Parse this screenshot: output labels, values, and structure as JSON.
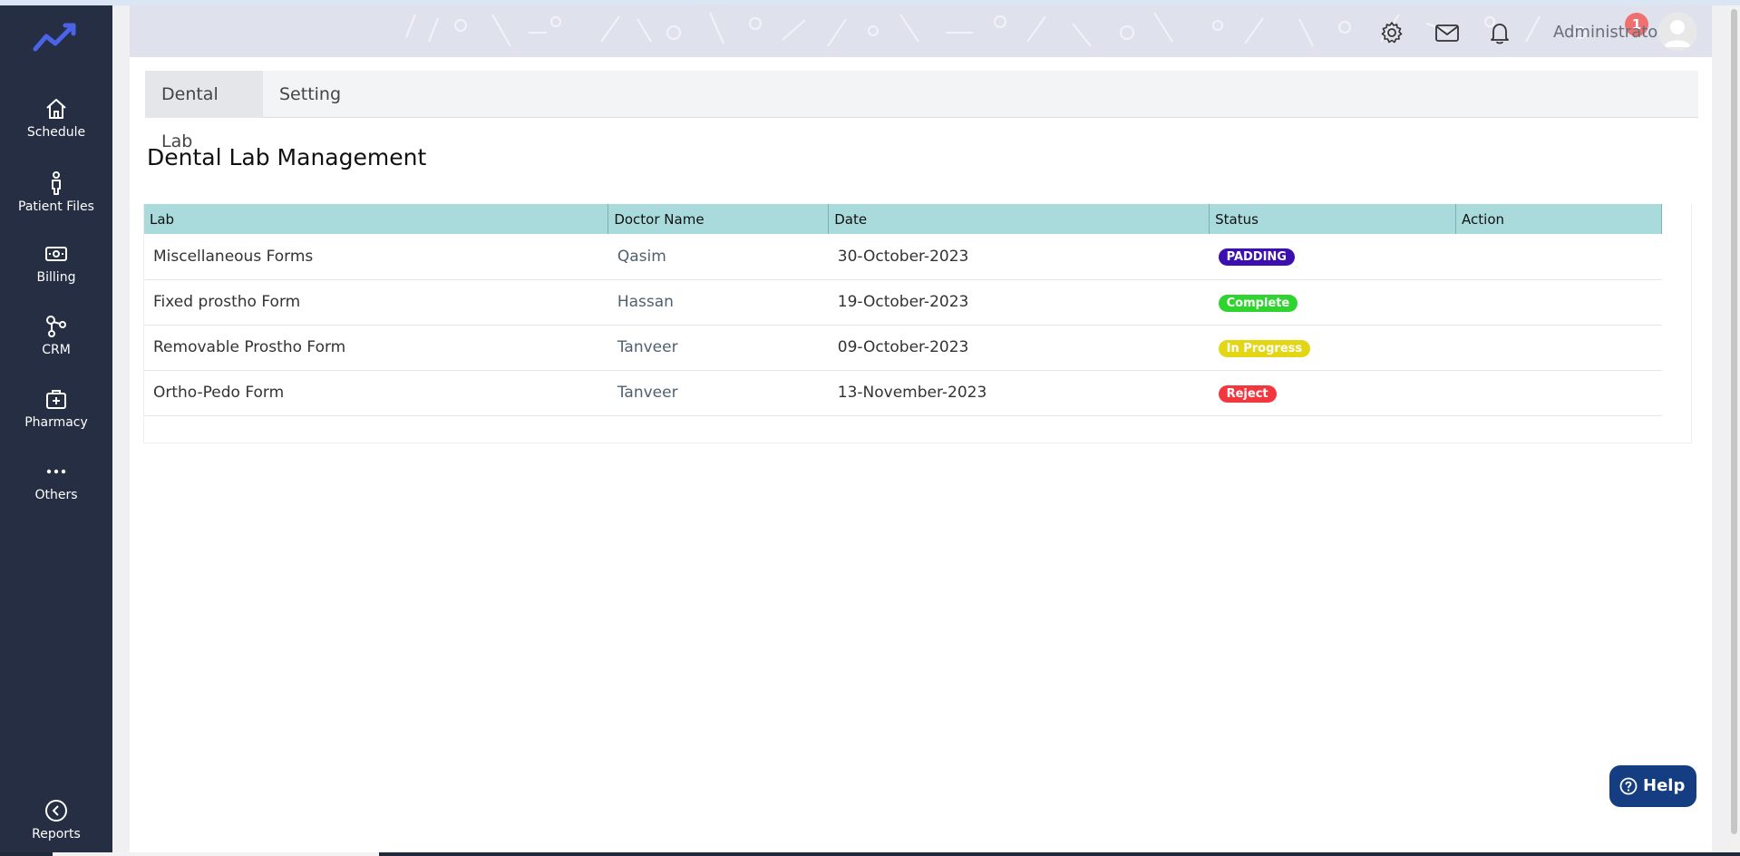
{
  "sidebar": {
    "items": [
      {
        "label": "Schedule",
        "icon": "home-icon"
      },
      {
        "label": "Patient Files",
        "icon": "person-icon"
      },
      {
        "label": "Billing",
        "icon": "money-icon"
      },
      {
        "label": "CRM",
        "icon": "network-icon"
      },
      {
        "label": "Pharmacy",
        "icon": "medkit-icon"
      },
      {
        "label": "Others",
        "icon": "dots-icon"
      }
    ],
    "reports_label": "Reports"
  },
  "header": {
    "user_name": "Administrator",
    "notification_count": "1"
  },
  "tabs": [
    {
      "label": "Dental Lab",
      "active": true
    },
    {
      "label": "Setting",
      "active": false
    }
  ],
  "page_title": "Dental Lab Management",
  "table": {
    "headers": [
      "Lab",
      "Doctor Name",
      "Date",
      "Status",
      "Action"
    ],
    "rows": [
      {
        "lab": "Miscellaneous Forms",
        "doctor": "Qasim",
        "date": "30-October-2023",
        "status": "PADDING",
        "status_color": "#3c0fb0"
      },
      {
        "lab": "Fixed prostho Form",
        "doctor": "Hassan",
        "date": "19-October-2023",
        "status": "Complete",
        "status_color": "#2fd42f"
      },
      {
        "lab": "Removable Prostho Form",
        "doctor": "Tanveer",
        "date": "09-October-2023",
        "status": "In Progress",
        "status_color": "#e3d615"
      },
      {
        "lab": "Ortho-Pedo Form",
        "doctor": "Tanveer",
        "date": "13-November-2023",
        "status": "Reject",
        "status_color": "#f2373f"
      }
    ]
  },
  "help_label": "Help",
  "colors": {
    "sidebar": "#252e42",
    "table_header": "#a9dbdc",
    "help_button": "#153e82",
    "badge": "#f07070"
  }
}
